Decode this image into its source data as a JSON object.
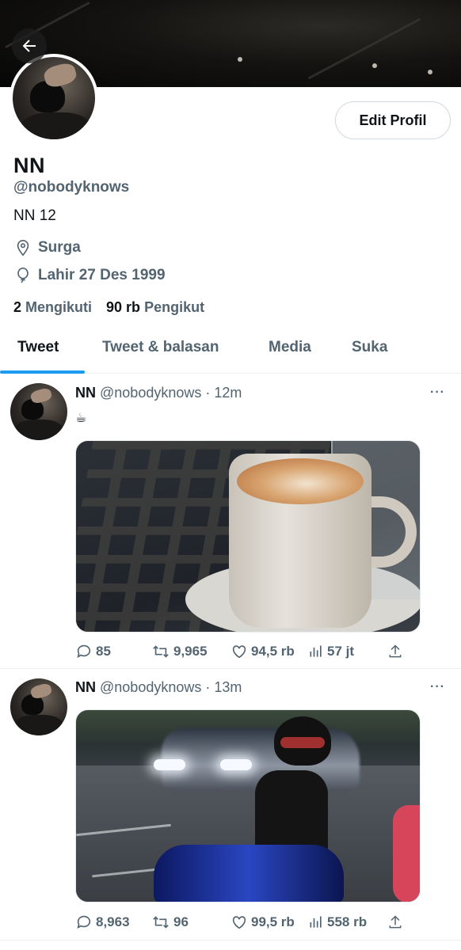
{
  "profile": {
    "display_name": "NN",
    "handle": "@nobodyknows",
    "bio": "NN 12",
    "location": "Surga",
    "birthday": "Lahir 27 Des 1999",
    "following_count": "2",
    "following_label": "Mengikuti",
    "followers_count": "90 rb",
    "followers_label": "Pengikut",
    "edit_button": "Edit Profil"
  },
  "tabs": [
    {
      "label": "Tweet",
      "active": true
    },
    {
      "label": "Tweet & balasan",
      "active": false
    },
    {
      "label": "Media",
      "active": false
    },
    {
      "label": "Suka",
      "active": false
    }
  ],
  "tweets": [
    {
      "name": "NN",
      "handle_time": "@nobodyknows · 12m",
      "text": "☕",
      "replies": "85",
      "retweets": "9,965",
      "likes": "94,5 rb",
      "views": "57 jt"
    },
    {
      "name": "NN",
      "handle_time": "@nobodyknows · 13m",
      "replies": "8,963",
      "retweets": "96",
      "likes": "99,5 rb",
      "views": "558 rb"
    }
  ],
  "more_label": "···",
  "colors": {
    "accent": "#1d9bf0",
    "secondary_text": "#536471",
    "primary_text": "#0f1419"
  }
}
